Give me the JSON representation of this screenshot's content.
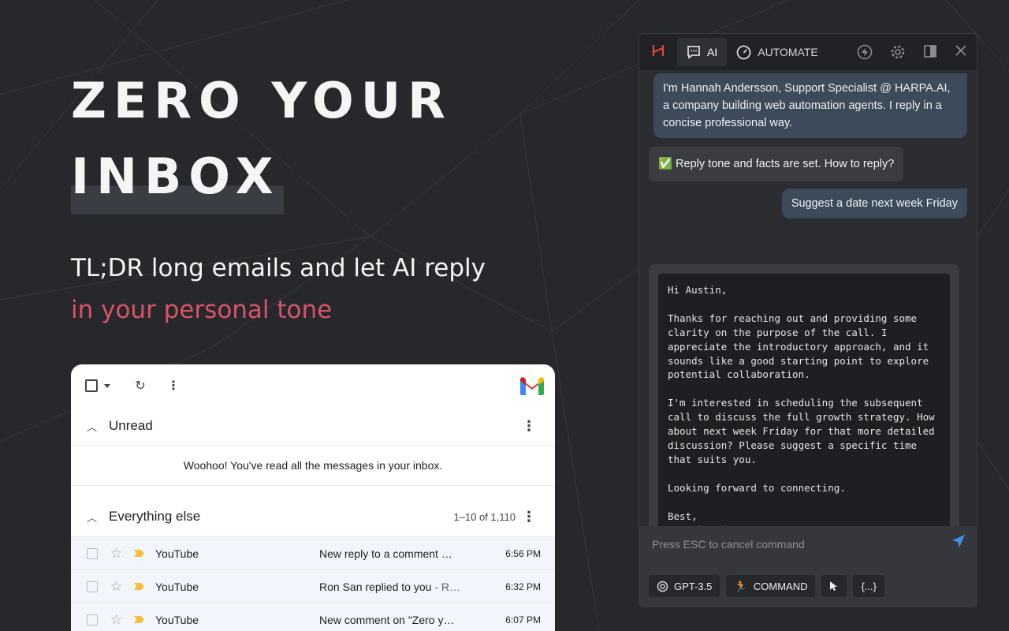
{
  "hero": {
    "title_line1": "ZERO YOUR",
    "title_line2": "INBOX",
    "subtitle": "TL;DR long emails and let AI reply",
    "subtitle_accent": "in your personal tone",
    "accent_color": "#d9536a"
  },
  "gmail": {
    "sections": {
      "unread": "Unread",
      "empty_message": "Woohoo! You've read all the messages in your inbox.",
      "everything_else": "Everything else",
      "range": "1–10 of 1,110"
    },
    "rows": [
      {
        "sender": "YouTube",
        "subject": "New reply to a comment …",
        "snippet": "",
        "time": "6:56 PM"
      },
      {
        "sender": "YouTube",
        "subject": "Ron San replied to you",
        "snippet": " - R…",
        "time": "6:32 PM"
      },
      {
        "sender": "YouTube",
        "subject": "New comment on \"Zero y…",
        "snippet": "",
        "time": "6:07 PM"
      }
    ]
  },
  "panel": {
    "tabs": {
      "ai": "AI",
      "automate": "AUTOMATE"
    },
    "messages": {
      "intro": "I'm Hannah Andersson, Support Specialist @ HARPA.AI, a company building web automation agents. I reply in a concise professional way.",
      "ack": "✅ Reply tone and facts are set. How to reply?",
      "request": "Suggest a date next week Friday",
      "reply": "Hi Austin,\n\nThanks for reaching out and providing some\nclarity on the purpose of the call. I\nappreciate the introductory approach, and it\nsounds like a good starting point to explore\npotential collaboration.\n\nI'm interested in scheduling the subsequent\ncall to discuss the full growth strategy. How\nabout next week Friday for that more detailed\ndiscussion? Please suggest a specific time\nthat suits you.\n\nLooking forward to connecting.\n\nBest,\nHannah Andersson\nSupport Specialist @ HARPA.AI"
    },
    "input": {
      "placeholder": "Press ESC to cancel command"
    },
    "buttons": {
      "model": "GPT-3.5",
      "command": "COMMAND",
      "braces": "{...}"
    },
    "send_color": "#3a8fe8"
  }
}
